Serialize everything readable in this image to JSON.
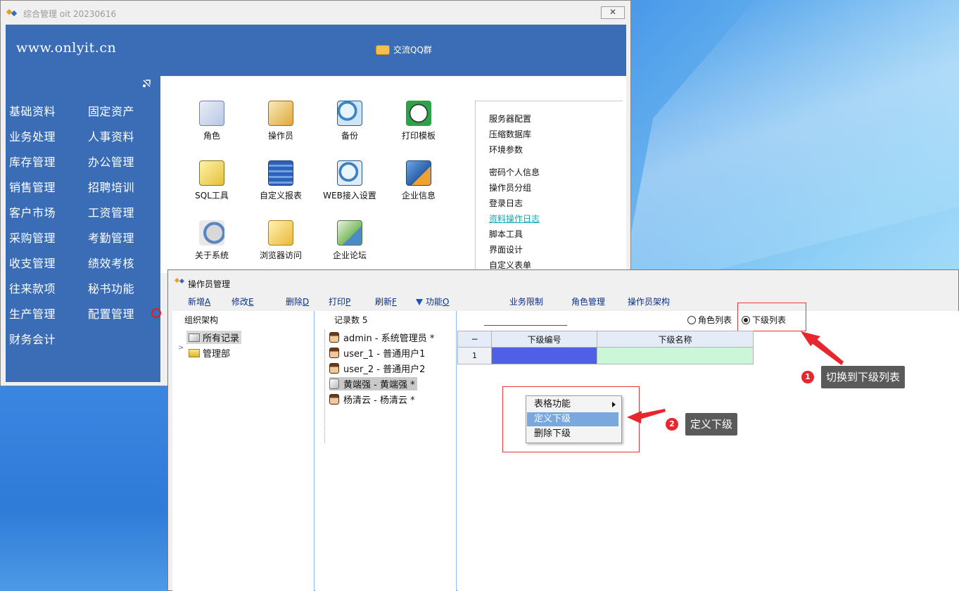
{
  "main_window": {
    "title": "综合管理 oit 20230616",
    "close_label": "✕",
    "site": "www.onlyit.cn",
    "qq_group": "交流QQ群"
  },
  "nav": {
    "items": [
      "基础资料",
      "固定资产",
      "业务处理",
      "人事资料",
      "库存管理",
      "办公管理",
      "销售管理",
      "招聘培训",
      "客户市场",
      "工资管理",
      "采购管理",
      "考勤管理",
      "收支管理",
      "绩效考核",
      "往来款项",
      "秘书功能",
      "生产管理",
      "配置管理",
      "财务会计"
    ]
  },
  "tiles": [
    {
      "label": "角色",
      "icon": "role-icon"
    },
    {
      "label": "操作员",
      "icon": "operator-icon"
    },
    {
      "label": "备份",
      "icon": "backup-icon"
    },
    {
      "label": "打印模板",
      "icon": "print-template-icon"
    },
    {
      "label": "SQL工具",
      "icon": "sql-tool-icon"
    },
    {
      "label": "自定义报表",
      "icon": "custom-report-icon"
    },
    {
      "label": "WEB接入设置",
      "icon": "web-access-icon"
    },
    {
      "label": "企业信息",
      "icon": "company-info-icon"
    },
    {
      "label": "关于系统",
      "icon": "about-icon"
    },
    {
      "label": "浏览器访问",
      "icon": "browser-icon"
    },
    {
      "label": "企业论坛",
      "icon": "forum-icon"
    }
  ],
  "right_links": [
    "服务器配置",
    "压缩数据库",
    "环境参数",
    "密码个人信息",
    "操作员分组",
    "登录日志",
    "资料操作日志",
    "脚本工具",
    "界面设计",
    "自定义表单"
  ],
  "operator_window": {
    "title": "操作员管理",
    "toolbar": {
      "add": {
        "text": "新增",
        "key": "A"
      },
      "edit": {
        "text": "修改",
        "key": "E"
      },
      "delete": {
        "text": "删除",
        "key": "D"
      },
      "print": {
        "text": "打印",
        "key": "P"
      },
      "refresh": {
        "text": "刷新",
        "key": "F"
      },
      "func": {
        "text": "功能",
        "key": "O"
      },
      "business_limit": "业务限制",
      "role_manage": "角色管理",
      "operator_structure": "操作员架构"
    },
    "org": {
      "header": "组织架构",
      "all_records": "所有记录",
      "dept": "管理部",
      "expander": ">"
    },
    "users": {
      "header": "记录数 5",
      "rows": [
        "admin - 系统管理员 *",
        "user_1 - 普通用户1",
        "user_2 - 普通用户2",
        "黄端强 - 黄端强 *",
        "杨清云 - 杨清云 *"
      ]
    },
    "grid": {
      "radio_role": "角色列表",
      "radio_sub": "下级列表",
      "col_minus": "−",
      "col_code": "下级编号",
      "col_name": "下级名称",
      "row_num": "1"
    }
  },
  "context_menu": {
    "items": [
      "表格功能",
      "定义下级",
      "删除下级"
    ]
  },
  "annotations": {
    "badge1": "1",
    "callout1": "切换到下级列表",
    "badge2": "2",
    "callout2": "定义下级"
  },
  "colors": {
    "nav_blue": "#3a6db5",
    "annotation_red": "#e23a3a",
    "grid_code_cell": "#5060e6",
    "grid_name_cell": "#c9f7d8",
    "menu_highlight": "#7aa7dc"
  }
}
